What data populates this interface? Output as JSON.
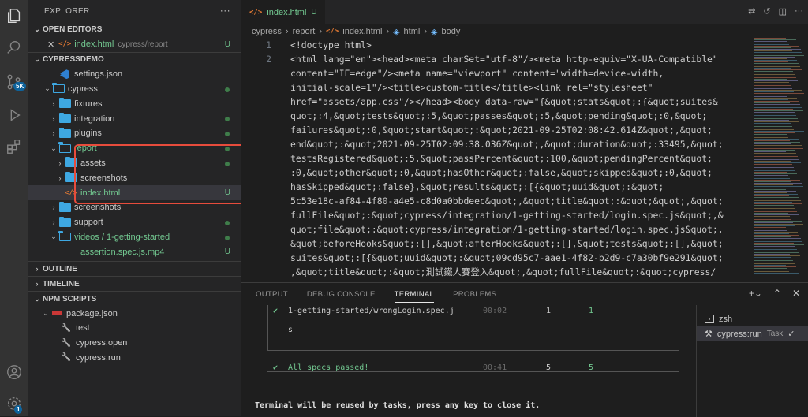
{
  "activity": {
    "scm_badge": "5K",
    "accounts_badge": "1"
  },
  "explorer": {
    "title": "EXPLORER",
    "more": "···",
    "open_editors": {
      "label": "OPEN EDITORS",
      "file": "index.html",
      "path": "cypress/report",
      "status": "U"
    },
    "project": {
      "label": "CYPRESSDEMO"
    },
    "tree": [
      {
        "name": "settings.json",
        "indent": 1,
        "kind": "vscode"
      },
      {
        "name": "cypress",
        "indent": 0,
        "kind": "folder-open",
        "twisty": "⌄",
        "dot": true
      },
      {
        "name": "fixtures",
        "indent": 1,
        "kind": "folder",
        "twisty": "›"
      },
      {
        "name": "integration",
        "indent": 1,
        "kind": "folder",
        "twisty": "›",
        "dot": true
      },
      {
        "name": "plugins",
        "indent": 1,
        "kind": "folder",
        "twisty": "›",
        "dot": true
      },
      {
        "name": "report",
        "indent": 1,
        "kind": "folder-open",
        "twisty": "⌄",
        "dot": true,
        "green": true
      },
      {
        "name": "assets",
        "indent": 2,
        "kind": "folder",
        "twisty": "›",
        "dot": true
      },
      {
        "name": "screenshots",
        "indent": 2,
        "kind": "folder",
        "twisty": "›"
      },
      {
        "name": "index.html",
        "indent": 2,
        "kind": "html",
        "status": "U",
        "green": true,
        "selected": true
      },
      {
        "name": "screenshots",
        "indent": 1,
        "kind": "folder",
        "twisty": "›"
      },
      {
        "name": "support",
        "indent": 1,
        "kind": "folder",
        "twisty": "›",
        "dot": true
      },
      {
        "name": "videos / 1-getting-started",
        "indent": 1,
        "kind": "folder-open",
        "twisty": "⌄",
        "dot": true,
        "green": true
      },
      {
        "name": "assertion.spec.js.mp4",
        "indent": 2,
        "kind": "mp4",
        "status": "U",
        "green": true
      }
    ],
    "outline": "OUTLINE",
    "timeline": "TIMELINE",
    "npm_scripts": "NPM SCRIPTS",
    "npm_file": "package.json",
    "npm_items": [
      "test",
      "cypress:open",
      "cypress:run"
    ]
  },
  "editor": {
    "tab": {
      "icon": "</>",
      "label": "index.html",
      "status": "U"
    },
    "breadcrumbs": [
      "cypress",
      "report",
      "index.html",
      "html",
      "body"
    ],
    "line_numbers": [
      "1",
      "2"
    ],
    "code_lines": [
      "<!doctype html>",
      "<html lang=\"en\"><head><meta charSet=\"utf-8\"/><meta http-equiv=\"X-UA-Compatible\"",
      "content=\"IE=edge\"/><meta name=\"viewport\" content=\"width=device-width,",
      "initial-scale=1\"/><title>custom-title</title><link rel=\"stylesheet\"",
      "href=\"assets/app.css\"/></head><body data-raw=\"{&quot;stats&quot;:{&quot;suites&",
      "quot;:4,&quot;tests&quot;:5,&quot;passes&quot;:5,&quot;pending&quot;:0,&quot;",
      "failures&quot;:0,&quot;start&quot;:&quot;2021-09-25T02:08:42.614Z&quot;,&quot;",
      "end&quot;:&quot;2021-09-25T02:09:38.036Z&quot;,&quot;duration&quot;:33495,&quot;",
      "testsRegistered&quot;:5,&quot;passPercent&quot;:100,&quot;pendingPercent&quot;",
      ":0,&quot;other&quot;:0,&quot;hasOther&quot;:false,&quot;skipped&quot;:0,&quot;",
      "hasSkipped&quot;:false},&quot;results&quot;:[{&quot;uuid&quot;:&quot;",
      "5c53e18c-af84-4f80-a4e5-c8d0a0bbdeec&quot;,&quot;title&quot;:&quot;&quot;,&quot;",
      "fullFile&quot;:&quot;cypress/integration/1-getting-started/login.spec.js&quot;,&",
      "quot;file&quot;:&quot;cypress/integration/1-getting-started/login.spec.js&quot;,",
      "&quot;beforeHooks&quot;:[],&quot;afterHooks&quot;:[],&quot;tests&quot;:[],&quot;",
      "suites&quot;:[{&quot;uuid&quot;:&quot;09cd95c7-aae1-4f82-b2d9-c7a30bf9e291&quot;",
      ",&quot;title&quot;:&quot;測試鐵人賽登入&quot;,&quot;fullFile&quot;:&quot;cypress/"
    ]
  },
  "panel": {
    "tabs": [
      "OUTPUT",
      "DEBUG CONSOLE",
      "TERMINAL",
      "PROBLEMS"
    ],
    "active_tab": "TERMINAL",
    "terminal": {
      "row1": {
        "check": "✔",
        "spec": "1-getting-started/wrongLogin.spec.j",
        "time": "00:02",
        "tests": "1",
        "passing": "1"
      },
      "row1_cont": "s",
      "summary": {
        "check": "✔",
        "text": "All specs passed!",
        "time": "00:41",
        "tests": "5",
        "passing": "5"
      },
      "footer": "Terminal will be reused by tasks, press any key to close it."
    },
    "terminals": [
      {
        "name": "zsh"
      },
      {
        "name": "cypress:run",
        "tag": "Task",
        "check": "✓"
      }
    ]
  },
  "colors": {
    "accent": "#0e639c",
    "green": "#73c991",
    "highlight_box": "#e74c3c"
  }
}
